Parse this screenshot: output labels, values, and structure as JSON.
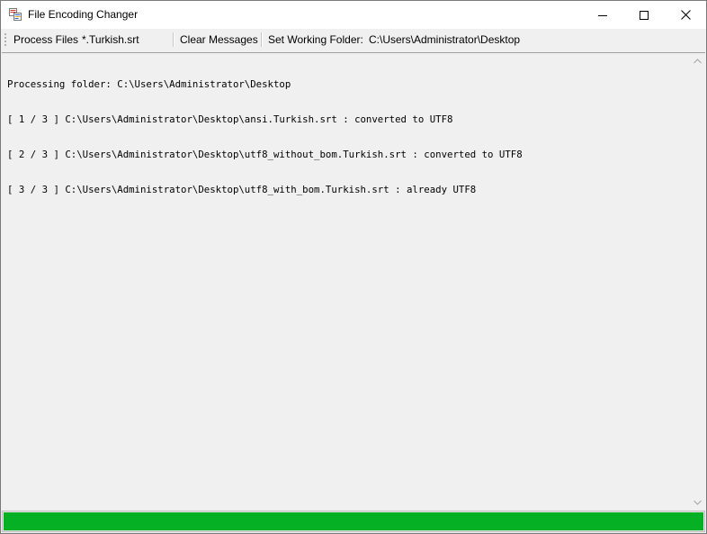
{
  "window": {
    "title": "File Encoding Changer",
    "icon": "app-icon"
  },
  "toolbar": {
    "process_files": "Process Files",
    "file_filter": "*.Turkish.srt",
    "clear_messages": "Clear Messages",
    "set_working_folder": "Set Working Folder:",
    "working_folder_path": "C:\\Users\\Administrator\\Desktop"
  },
  "log": {
    "lines": [
      "Processing folder: C:\\Users\\Administrator\\Desktop",
      "[ 1 / 3 ] C:\\Users\\Administrator\\Desktop\\ansi.Turkish.srt : converted to UTF8",
      "[ 2 / 3 ] C:\\Users\\Administrator\\Desktop\\utf8_without_bom.Turkish.srt : converted to UTF8",
      "[ 3 / 3 ] C:\\Users\\Administrator\\Desktop\\utf8_with_bom.Turkish.srt : already UTF8"
    ]
  },
  "progress": {
    "value": 1.0,
    "color": "#06b025"
  },
  "colors": {
    "titlebar_bg": "#ffffff",
    "window_bg": "#f0f0f0",
    "progress_green": "#06b025"
  }
}
